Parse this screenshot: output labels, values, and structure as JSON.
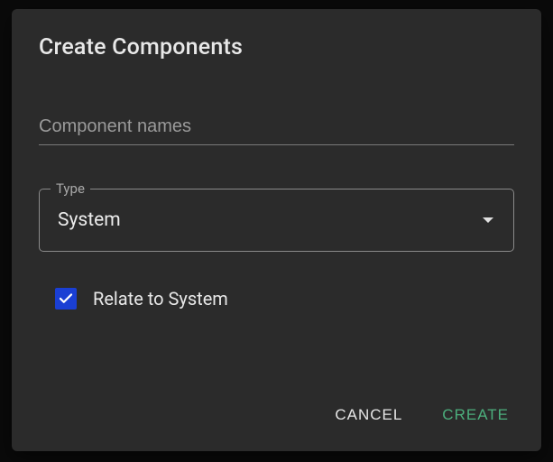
{
  "dialog": {
    "title": "Create Components",
    "componentNames": {
      "placeholder": "Component names",
      "value": ""
    },
    "typeField": {
      "label": "Type",
      "value": "System"
    },
    "relateCheckbox": {
      "label": "Relate to System",
      "checked": true
    },
    "actions": {
      "cancel": "CANCEL",
      "create": "CREATE"
    }
  }
}
